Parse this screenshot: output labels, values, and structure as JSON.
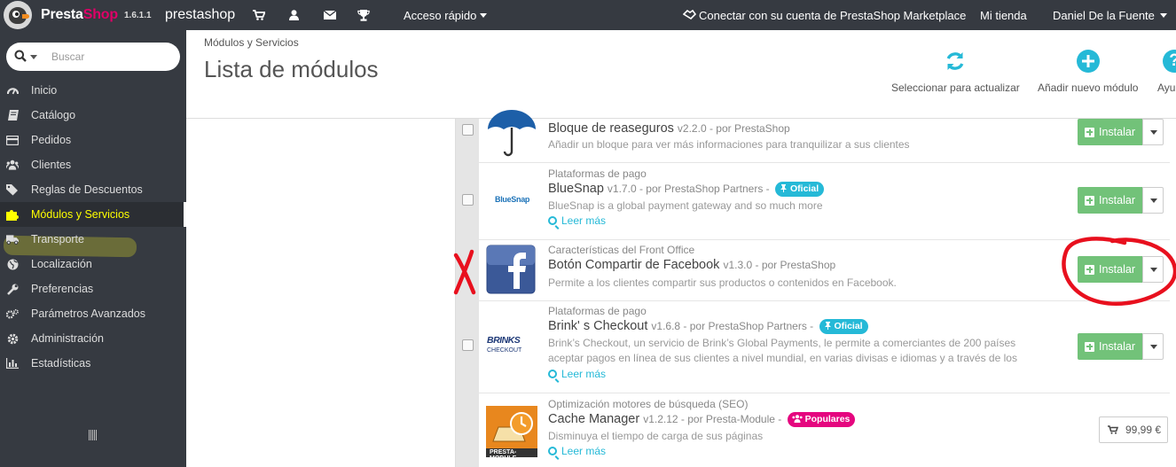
{
  "topbar": {
    "brand_part1": "Presta",
    "brand_part2": "Shop",
    "version": "1.6.1.1",
    "shop_name": "prestashop",
    "quick_access": "Acceso rápido",
    "marketplace": "Conectar con su cuenta de PrestaShop Marketplace",
    "my_shop": "Mi tienda",
    "user": "Daniel De la Fuente",
    "icons": [
      "cart-icon",
      "user-icon",
      "envelope-icon",
      "trophy-icon"
    ]
  },
  "sidebar": {
    "search_placeholder": "Buscar",
    "items": [
      {
        "label": "Inicio",
        "icon": "dashboard-icon"
      },
      {
        "label": "Catálogo",
        "icon": "book-icon"
      },
      {
        "label": "Pedidos",
        "icon": "credit-card-icon"
      },
      {
        "label": "Clientes",
        "icon": "users-icon"
      },
      {
        "label": "Reglas de Descuentos",
        "icon": "tags-icon"
      },
      {
        "label": "Módulos y Servicios",
        "icon": "puzzle-icon"
      },
      {
        "label": "Transporte",
        "icon": "truck-icon"
      },
      {
        "label": "Localización",
        "icon": "globe-icon"
      },
      {
        "label": "Preferencias",
        "icon": "wrench-icon"
      },
      {
        "label": "Parámetros Avanzados",
        "icon": "cogs-icon"
      },
      {
        "label": "Administración",
        "icon": "cog-icon"
      },
      {
        "label": "Estadísticas",
        "icon": "bar-chart-icon"
      }
    ],
    "active_index": 5
  },
  "header": {
    "breadcrumb": "Módulos y Servicios",
    "title": "Lista de módulos",
    "tools": [
      {
        "label": "Seleccionar para actualizar",
        "icon": "refresh-icon"
      },
      {
        "label": "Añadir nuevo módulo",
        "icon": "plus-circle-icon"
      },
      {
        "label": "Ayu",
        "icon": "question-icon"
      }
    ]
  },
  "modules": [
    {
      "category": "",
      "name": "Bloque de reaseguros",
      "meta": "v2.2.0 - por PrestaShop",
      "badge": "",
      "description": "Añadir un bloque para ver más informaciones para tranquilizar a sus clientes",
      "more": "",
      "action": "Instalar"
    },
    {
      "category": "Plataformas de pago",
      "name": "BlueSnap",
      "meta": "v1.7.0 - por PrestaShop Partners - ",
      "badge": "Oficial",
      "description": "BlueSnap is a global payment gateway and so much more",
      "more": "Leer más",
      "action": "Instalar",
      "thumb_text": "BlueSnap"
    },
    {
      "category": "Características del Front Office",
      "name": "Botón Compartir de Facebook",
      "meta": "v1.3.0 - por PrestaShop",
      "badge": "",
      "description": "Permite a los clientes compartir sus productos o contenidos en Facebook.",
      "more": "",
      "action": "Instalar"
    },
    {
      "category": "Plataformas de pago",
      "name": "Brink' s Checkout",
      "meta": "v1.6.8 - por PrestaShop Partners - ",
      "badge": "Oficial",
      "description": "Brink’s Checkout, un servicio de Brink’s Global Payments, le permite a comerciantes de 200 países aceptar pagos en línea de sus clientes a nivel mundial, en varias divisas e idiomas y a través de los",
      "more": "Leer más",
      "action": "Instalar",
      "thumb_text_1": "BRINKS",
      "thumb_text_2": "CHECKOUT"
    },
    {
      "category": "Optimización motores de búsqueda (SEO)",
      "name": "Cache Manager",
      "meta": "v1.2.12 - por Presta-Module - ",
      "badge": "Populares",
      "description": "Disminuya el tiempo de carga de sus páginas",
      "more": "Leer más",
      "price": "99,99 €",
      "thumb_text": "PRESTA-MODULE"
    }
  ],
  "colors": {
    "topbar": "#363a41",
    "accent": "#25b9d7",
    "install": "#72c279",
    "popular": "#e5067f",
    "annotation": "#e8101e"
  }
}
